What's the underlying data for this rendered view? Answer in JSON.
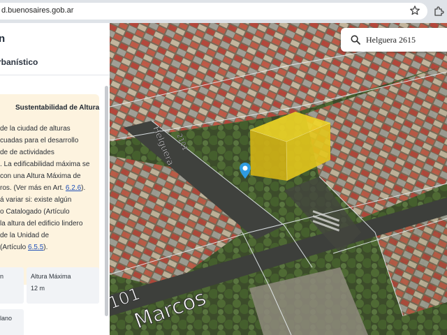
{
  "browser": {
    "url": "d.buenosaires.gob.ar"
  },
  "sidebar": {
    "title": "n",
    "subtitle": "rbanístico",
    "info_card": {
      "title": "Sustentabilidad de Altura",
      "lines": [
        "de la ciudad de alturas",
        "cuadas para el desarrollo",
        "de de actividades",
        ". La edificabilidad máxima se",
        "con una Altura Máxima de",
        "ros. (Ver más en Art. ",
        "á variar si: existe algún",
        "o Catalogado (Artículo",
        "la altura del edificio lindero",
        "de la Unidad de",
        "(Artículo "
      ],
      "link_1": "6.2.6",
      "link_1_suffix": ").",
      "link_2": "6.5.5",
      "link_2_suffix": ")."
    },
    "tiles": [
      {
        "label": "n",
        "value": ""
      },
      {
        "label": "Altura Máxima",
        "value": "12 m"
      },
      {
        "label": "lano",
        "value": ""
      }
    ]
  },
  "map": {
    "search_value": "Helguera 2615",
    "street_labels": [
      "Helguera",
      "2101",
      "Marcos",
      "101"
    ]
  },
  "colors": {
    "accent_yellow": "#e8cc1a",
    "pin": "#2f9be0",
    "card_bg": "#fdf3df",
    "link": "#1f4fb8"
  }
}
